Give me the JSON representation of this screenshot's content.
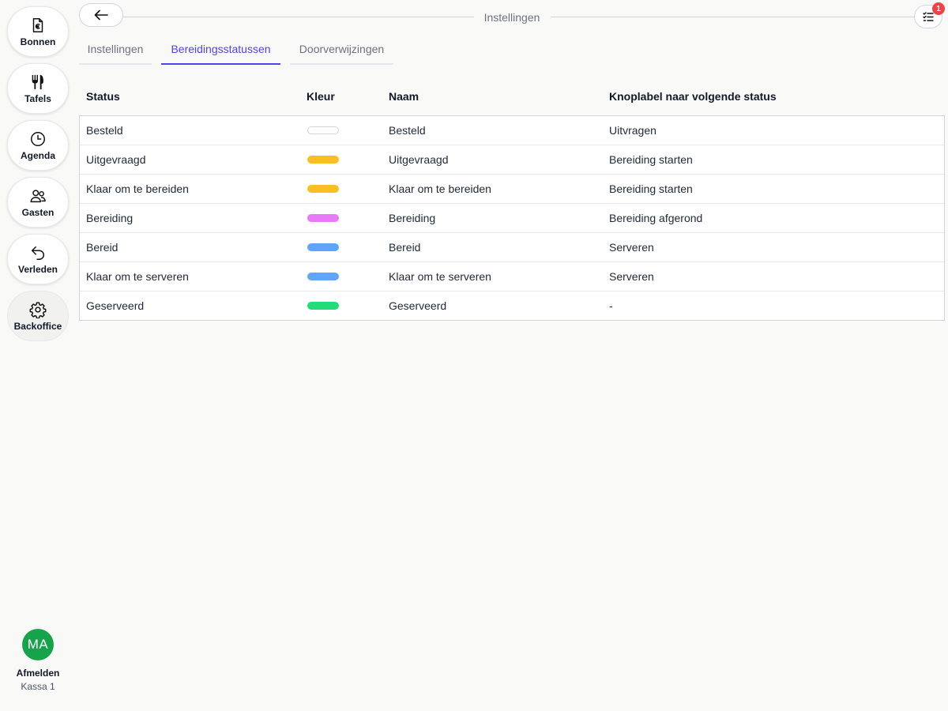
{
  "sidebar": {
    "items": [
      {
        "label": "Bonnen",
        "icon": "receipt-euro-icon"
      },
      {
        "label": "Tafels",
        "icon": "fork-knife-icon"
      },
      {
        "label": "Agenda",
        "icon": "clock-icon"
      },
      {
        "label": "Gasten",
        "icon": "users-icon"
      },
      {
        "label": "Verleden",
        "icon": "undo-arrow-icon"
      },
      {
        "label": "Backoffice",
        "icon": "gear-icon",
        "active": true
      }
    ],
    "user": {
      "initials": "MA",
      "logout_label": "Afmelden",
      "register": "Kassa 1",
      "avatar_color": "#16a34a"
    }
  },
  "header": {
    "title": "Instellingen",
    "back_icon": "arrow-left-icon",
    "tasks_icon": "checklist-icon",
    "tasks_badge": "1"
  },
  "tabs": [
    {
      "label": "Instellingen",
      "active": false
    },
    {
      "label": "Bereidingsstatussen",
      "active": true
    },
    {
      "label": "Doorverwijzingen",
      "active": false
    }
  ],
  "table": {
    "columns": [
      "Status",
      "Kleur",
      "Naam",
      "Knoplabel naar volgende status"
    ],
    "rows": [
      {
        "status": "Besteld",
        "color": "#ffffff",
        "name": "Besteld",
        "button_label": "Uitvragen"
      },
      {
        "status": "Uitgevraagd",
        "color": "#fbbf24",
        "name": "Uitgevraagd",
        "button_label": "Bereiding starten"
      },
      {
        "status": "Klaar om te bereiden",
        "color": "#fbbf24",
        "name": "Klaar om te bereiden",
        "button_label": "Bereiding starten"
      },
      {
        "status": "Bereiding",
        "color": "#e879f9",
        "name": "Bereiding",
        "button_label": "Bereiding afgerond"
      },
      {
        "status": "Bereid",
        "color": "#60a5fa",
        "name": "Bereid",
        "button_label": "Serveren"
      },
      {
        "status": "Klaar om te serveren",
        "color": "#60a5fa",
        "name": "Klaar om te serveren",
        "button_label": "Serveren"
      },
      {
        "status": "Geserveerd",
        "color": "#22dd77",
        "name": "Geserveerd",
        "button_label": "-"
      }
    ]
  }
}
